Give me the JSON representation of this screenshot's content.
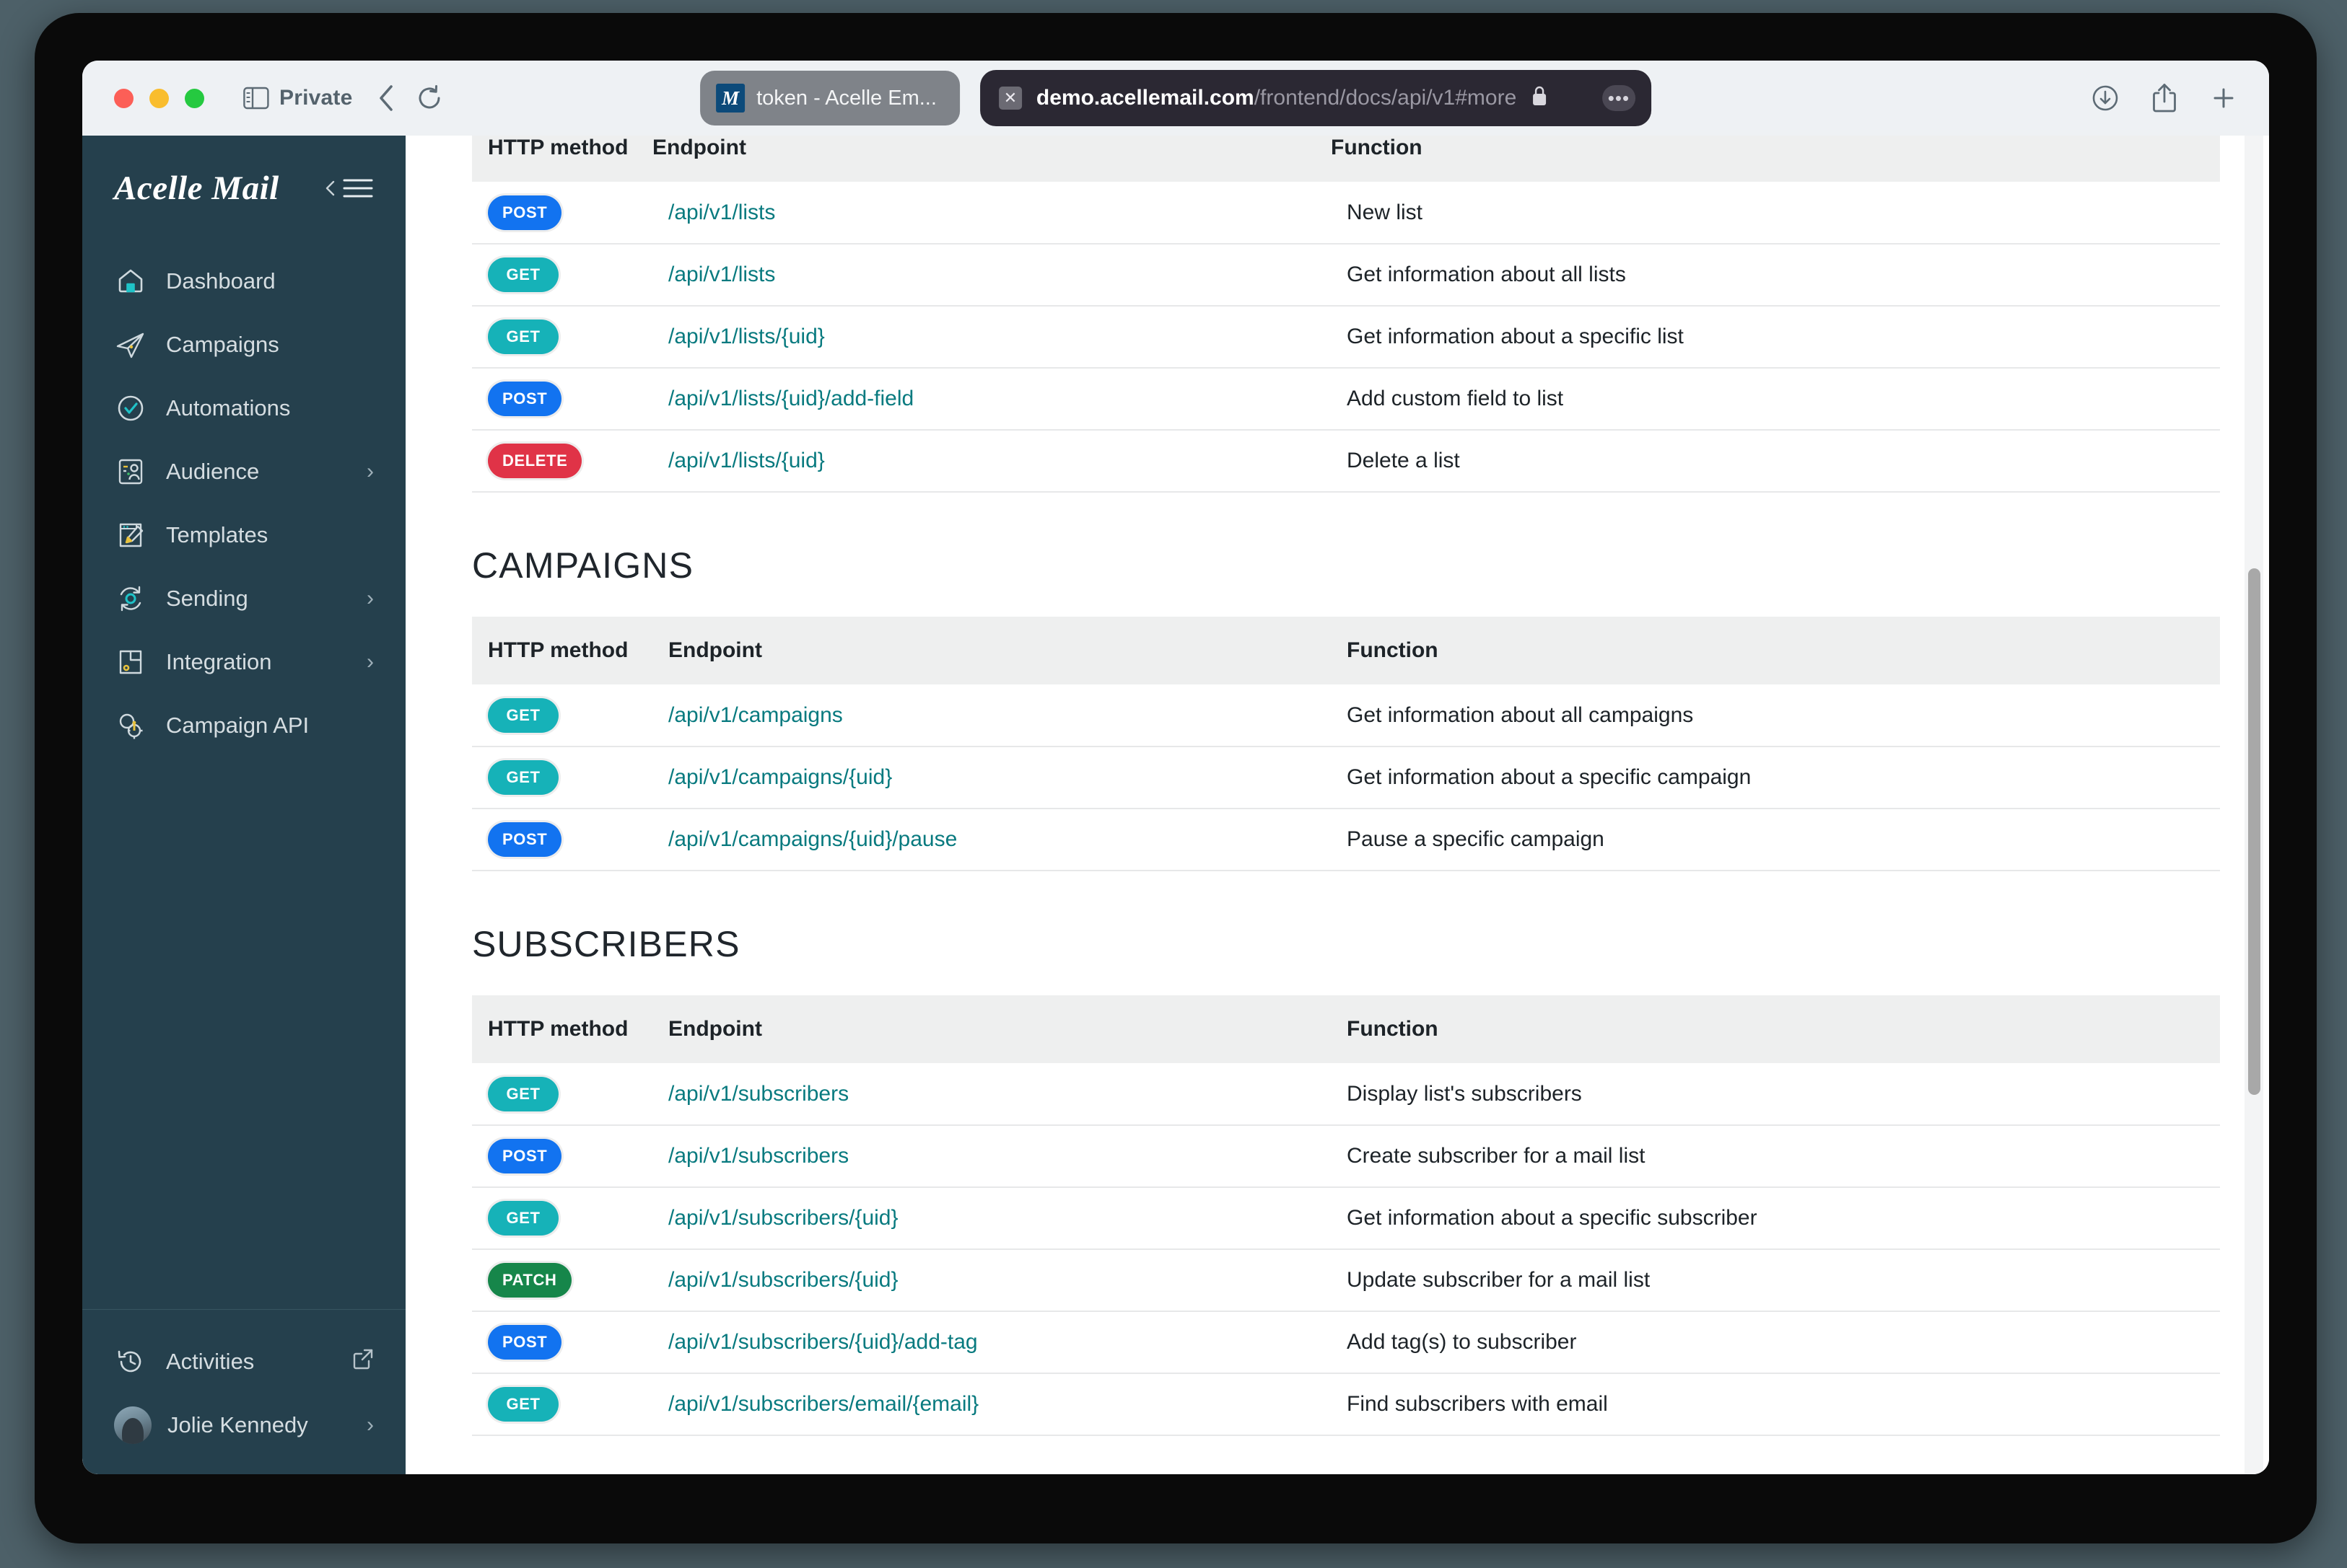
{
  "browser": {
    "private_label": "Private",
    "sidebar_toggle_icon": "sidebar-icon",
    "back_icon": "chevron-left-icon",
    "reload_icon": "reload-icon",
    "download_icon": "download-icon",
    "share_icon": "share-icon",
    "new_tab_icon": "plus-icon",
    "tab": {
      "favicon_letter": "M",
      "title": "token - Acelle Em..."
    },
    "url": {
      "host": "demo.acellemail.com",
      "path": "/frontend/docs/api/v1#more",
      "lock_icon": "lock-icon",
      "close_icon": "close-icon",
      "more_label": "•••"
    }
  },
  "sidebar": {
    "brand": "Acelle Mail",
    "collapse_icon": "collapse-sidebar-icon",
    "items": [
      {
        "label": "Dashboard",
        "icon": "home-icon",
        "chevron": ""
      },
      {
        "label": "Campaigns",
        "icon": "paper-plane-icon",
        "chevron": ""
      },
      {
        "label": "Automations",
        "icon": "check-circle-icon",
        "chevron": ""
      },
      {
        "label": "Audience",
        "icon": "audience-icon",
        "chevron": "›"
      },
      {
        "label": "Templates",
        "icon": "brush-icon",
        "chevron": ""
      },
      {
        "label": "Sending",
        "icon": "sync-gear-icon",
        "chevron": "›"
      },
      {
        "label": "Integration",
        "icon": "plug-icon",
        "chevron": "›"
      },
      {
        "label": "Campaign API",
        "icon": "api-gear-icon",
        "chevron": ""
      }
    ],
    "bottom": [
      {
        "label": "Activities",
        "icon": "history-icon",
        "chevron": "external-link-icon"
      },
      {
        "label": "Jolie Kennedy",
        "icon": "avatar",
        "chevron": "›"
      }
    ]
  },
  "main": {
    "clipped_header": {
      "method": "HTTP method",
      "endpoint": "Endpoint",
      "function": "Function"
    },
    "columns": {
      "method": "HTTP method",
      "endpoint": "Endpoint",
      "function": "Function"
    },
    "lists_rows": [
      {
        "method": "POST",
        "cls": "post",
        "endpoint": "/api/v1/lists",
        "function": "New list"
      },
      {
        "method": "GET",
        "cls": "get",
        "endpoint": "/api/v1/lists",
        "function": "Get information about all lists"
      },
      {
        "method": "GET",
        "cls": "get",
        "endpoint": "/api/v1/lists/{uid}",
        "function": "Get information about a specific list"
      },
      {
        "method": "POST",
        "cls": "post",
        "endpoint": "/api/v1/lists/{uid}/add-field",
        "function": "Add custom field to list"
      },
      {
        "method": "DELETE",
        "cls": "delete",
        "endpoint": "/api/v1/lists/{uid}",
        "function": "Delete a list"
      }
    ],
    "campaigns": {
      "title": "CAMPAIGNS",
      "rows": [
        {
          "method": "GET",
          "cls": "get",
          "endpoint": "/api/v1/campaigns",
          "function": "Get information about all campaigns"
        },
        {
          "method": "GET",
          "cls": "get",
          "endpoint": "/api/v1/campaigns/{uid}",
          "function": "Get information about a specific campaign"
        },
        {
          "method": "POST",
          "cls": "post",
          "endpoint": "/api/v1/campaigns/{uid}/pause",
          "function": "Pause a specific campaign"
        }
      ]
    },
    "subscribers": {
      "title": "SUBSCRIBERS",
      "rows": [
        {
          "method": "GET",
          "cls": "get",
          "endpoint": "/api/v1/subscribers",
          "function": "Display list's subscribers"
        },
        {
          "method": "POST",
          "cls": "post",
          "endpoint": "/api/v1/subscribers",
          "function": "Create subscriber for a mail list"
        },
        {
          "method": "GET",
          "cls": "get",
          "endpoint": "/api/v1/subscribers/{uid}",
          "function": "Get information about a specific subscriber"
        },
        {
          "method": "PATCH",
          "cls": "patch",
          "endpoint": "/api/v1/subscribers/{uid}",
          "function": "Update subscriber for a mail list"
        },
        {
          "method": "POST",
          "cls": "post",
          "endpoint": "/api/v1/subscribers/{uid}/add-tag",
          "function": "Add tag(s) to subscriber"
        },
        {
          "method": "GET",
          "cls": "get",
          "endpoint": "/api/v1/subscribers/email/{email}",
          "function": "Find subscribers with email"
        }
      ]
    }
  },
  "colors": {
    "sidebar_bg": "#25404d",
    "get": "#16b2b8",
    "post": "#1273f0",
    "delete": "#e03347",
    "patch": "#16864a",
    "endpoint_link": "#087a7f",
    "table_header_bg": "#eeefef"
  }
}
